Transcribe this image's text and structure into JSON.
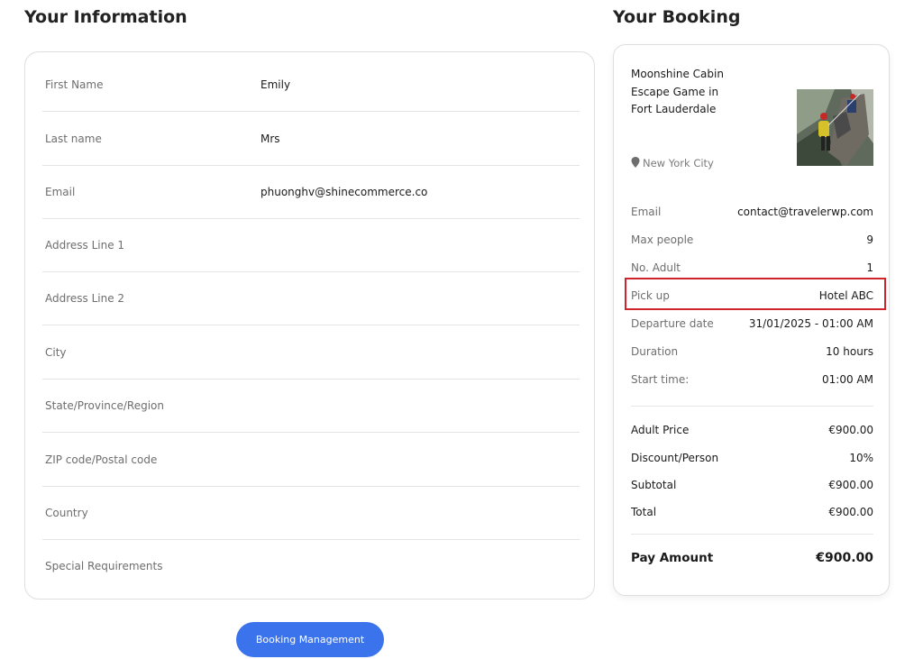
{
  "info": {
    "title": "Your Information",
    "fields": [
      {
        "label": "First Name",
        "value": "Emily"
      },
      {
        "label": "Last name",
        "value": "Mrs"
      },
      {
        "label": "Email",
        "value": "phuonghv@shinecommerce.co"
      },
      {
        "label": "Address Line 1",
        "value": ""
      },
      {
        "label": "Address Line 2",
        "value": ""
      },
      {
        "label": "City",
        "value": ""
      },
      {
        "label": "State/Province/Region",
        "value": ""
      },
      {
        "label": "ZIP code/Postal code",
        "value": ""
      },
      {
        "label": "Country",
        "value": ""
      },
      {
        "label": "Special Requirements",
        "value": ""
      }
    ],
    "button_label": "Booking Management"
  },
  "booking": {
    "title": "Your Booking",
    "tour_name": "Moonshine Cabin Escape Game in Fort Lauderdale",
    "location": "New York City",
    "location_icon": "map-pin-icon",
    "details": [
      {
        "label": "Email",
        "value": "contact@travelerwp.com"
      },
      {
        "label": "Max people",
        "value": "9"
      },
      {
        "label": "No. Adult",
        "value": "1"
      },
      {
        "label": "Pick up",
        "value": "Hotel ABC"
      },
      {
        "label": "Departure date",
        "value": "31/01/2025 - 01:00 AM"
      },
      {
        "label": "Duration",
        "value": "10 hours"
      },
      {
        "label": "Start time:",
        "value": "01:00 AM"
      }
    ],
    "prices": [
      {
        "label": "Adult Price",
        "value": "€900.00"
      },
      {
        "label": "Discount/Person",
        "value": "10%"
      },
      {
        "label": "Subtotal",
        "value": "€900.00"
      },
      {
        "label": "Total",
        "value": "€900.00"
      }
    ],
    "pay_label": "Pay Amount",
    "pay_value": "€900.00"
  },
  "colors": {
    "accent": "#3b73ec",
    "highlight": "#d0242b"
  }
}
